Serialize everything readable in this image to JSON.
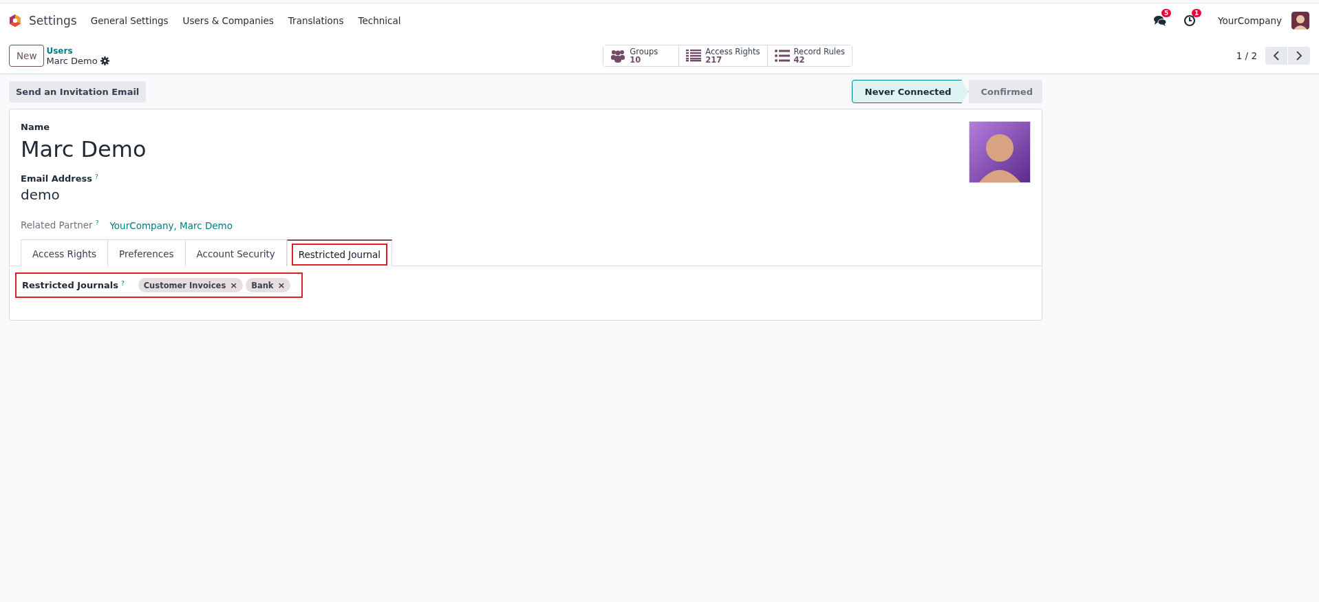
{
  "navbar": {
    "app": "Settings",
    "menus": [
      "General Settings",
      "Users & Companies",
      "Translations",
      "Technical"
    ],
    "notifications": [
      {
        "kind": "messages",
        "count": "5"
      },
      {
        "kind": "activities",
        "count": "1"
      }
    ],
    "company": "YourCompany"
  },
  "control_panel": {
    "new_button": "New",
    "breadcrumb": "Users",
    "record": "Marc Demo",
    "smart_buttons": [
      {
        "kind": "groups",
        "label": "Groups",
        "value": "10"
      },
      {
        "kind": "list",
        "label": "Access Rights",
        "value": "217"
      },
      {
        "kind": "bullets",
        "label": "Record Rules",
        "value": "42"
      }
    ],
    "pager": "1 / 2"
  },
  "actions": [
    "Send an Invitation Email"
  ],
  "status": [
    {
      "label": "Never Connected",
      "selected": true
    },
    {
      "label": "Confirmed",
      "selected": false
    }
  ],
  "form": {
    "name_label": "Name",
    "name": "Marc Demo",
    "email_label": "Email Address",
    "email_help": "?",
    "email": "demo",
    "partner_label": "Related Partner",
    "partner_help": "?",
    "partner": "YourCompany, Marc Demo",
    "tabs": [
      {
        "label": "Access Rights",
        "selected": false,
        "highlighted": false
      },
      {
        "label": "Preferences",
        "selected": false,
        "highlighted": false
      },
      {
        "label": "Account Security",
        "selected": false,
        "highlighted": false
      },
      {
        "label": "Restricted Journal",
        "selected": true,
        "highlighted": true
      }
    ],
    "journals": {
      "label": "Restricted Journals",
      "help": "?",
      "highlighted": true,
      "tags": [
        {
          "label": "Customer Invoices",
          "remove": "×"
        },
        {
          "label": "Bank",
          "remove": "×"
        }
      ]
    }
  }
}
